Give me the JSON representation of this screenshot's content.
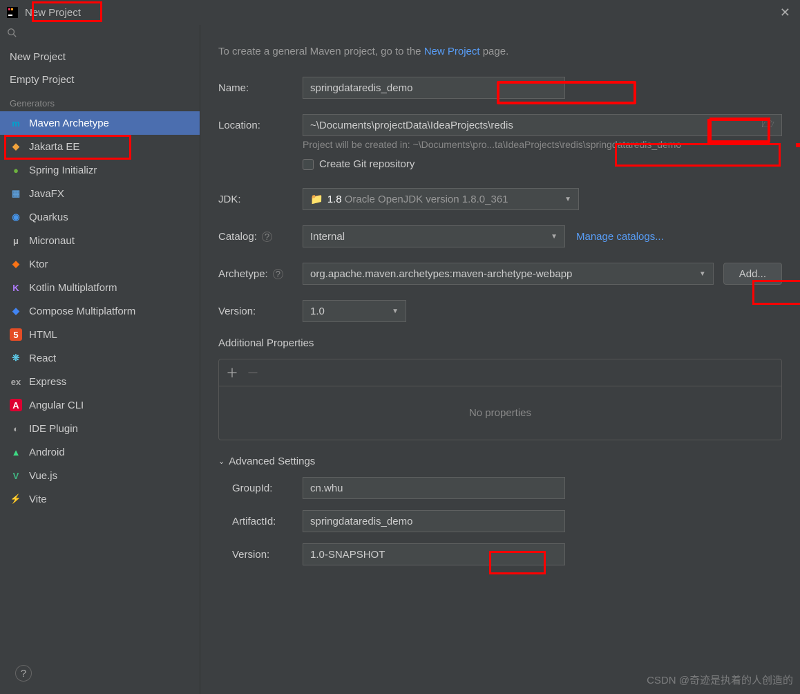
{
  "window": {
    "title": "New Project"
  },
  "sidebar": {
    "search_placeholder": "",
    "items": [
      "New Project",
      "Empty Project"
    ],
    "generators_label": "Generators",
    "generators": [
      {
        "label": "Maven Archetype",
        "selected": true,
        "icon": "m",
        "iconColor": "#00a3cc",
        "bg": ""
      },
      {
        "label": "Jakarta EE",
        "icon": "◆",
        "iconColor": "#f2a33c",
        "bg": ""
      },
      {
        "label": "Spring Initializr",
        "icon": "●",
        "iconColor": "#6db33f",
        "bg": ""
      },
      {
        "label": "JavaFX",
        "icon": "▦",
        "iconColor": "#5b9bd5",
        "bg": ""
      },
      {
        "label": "Quarkus",
        "icon": "◉",
        "iconColor": "#4695eb",
        "bg": ""
      },
      {
        "label": "Micronaut",
        "icon": "μ",
        "iconColor": "#bbb",
        "bg": ""
      },
      {
        "label": "Ktor",
        "icon": "◆",
        "iconColor": "#f97316",
        "bg": ""
      },
      {
        "label": "Kotlin Multiplatform",
        "icon": "K",
        "iconColor": "#b07cff",
        "bg": ""
      },
      {
        "label": "Compose Multiplatform",
        "icon": "◆",
        "iconColor": "#4285f4",
        "bg": ""
      },
      {
        "label": "HTML",
        "icon": "5",
        "iconColor": "#fff",
        "bg": "#e44d26"
      },
      {
        "label": "React",
        "icon": "❊",
        "iconColor": "#61dafb",
        "bg": ""
      },
      {
        "label": "Express",
        "icon": "ex",
        "iconColor": "#aaa",
        "bg": ""
      },
      {
        "label": "Angular CLI",
        "icon": "A",
        "iconColor": "#fff",
        "bg": "#dd0031"
      },
      {
        "label": "IDE Plugin",
        "icon": "◐",
        "iconColor": "#aaa",
        "bg": ""
      },
      {
        "label": "Android",
        "icon": "▲",
        "iconColor": "#3ddc84",
        "bg": ""
      },
      {
        "label": "Vue.js",
        "icon": "V",
        "iconColor": "#41b883",
        "bg": ""
      },
      {
        "label": "Vite",
        "icon": "⚡",
        "iconColor": "#b07cff",
        "bg": ""
      }
    ]
  },
  "main": {
    "intro_prefix": "To create a general Maven project, go to the ",
    "intro_link": "New Project",
    "intro_suffix": " page.",
    "name": {
      "label": "Name:",
      "value": "springdataredis_demo"
    },
    "location": {
      "label": "Location:",
      "value": "~\\Documents\\projectData\\IdeaProjects\\redis"
    },
    "location_hint": "Project will be created in: ~\\Documents\\pro...ta\\IdeaProjects\\redis\\springdataredis_demo",
    "create_git": "Create Git repository",
    "jdk": {
      "label": "JDK:",
      "value_prefix": "1.8",
      "value_suffix": " Oracle OpenJDK version 1.8.0_361"
    },
    "catalog": {
      "label": "Catalog:",
      "value": "Internal",
      "manage": "Manage catalogs..."
    },
    "archetype": {
      "label": "Archetype:",
      "value": "org.apache.maven.archetypes:maven-archetype-webapp",
      "add": "Add..."
    },
    "version": {
      "label": "Version:",
      "value": "1.0"
    },
    "props": {
      "title": "Additional Properties",
      "empty": "No properties"
    },
    "adv": {
      "title": "Advanced Settings",
      "group": {
        "label": "GroupId:",
        "value": "cn.whu"
      },
      "artifact": {
        "label": "ArtifactId:",
        "value": "springdataredis_demo"
      },
      "ver": {
        "label": "Version:",
        "value": "1.0-SNAPSHOT"
      }
    }
  },
  "watermark": "CSDN @奇迹是执着的人创造的"
}
